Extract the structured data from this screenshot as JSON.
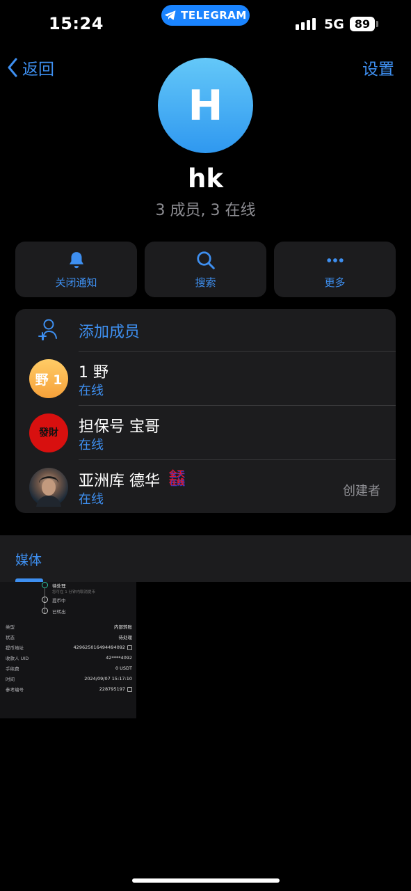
{
  "status_bar": {
    "time": "15:24",
    "app_pill": "TELEGRAM",
    "network": "5G",
    "battery": "89"
  },
  "nav": {
    "back_label": "返回",
    "settings_label": "设置"
  },
  "group": {
    "avatar_letter": "H",
    "name": "hk",
    "subtitle": "3 成员, 3 在线"
  },
  "actions": [
    {
      "label": "关闭通知",
      "icon": "bell-icon"
    },
    {
      "label": "搜索",
      "icon": "search-icon"
    },
    {
      "label": "更多",
      "icon": "more-icon"
    }
  ],
  "add_member_label": "添加成员",
  "members": [
    {
      "name": "1 野",
      "status": "在线",
      "avatar_text": "野 1",
      "role": ""
    },
    {
      "name": "担保号 宝哥",
      "status": "在线",
      "avatar_text": "發財",
      "role": ""
    },
    {
      "name": "亚洲库 德华",
      "status": "在线",
      "avatar_text": "",
      "role": "创建者",
      "badge": "全天在线"
    }
  ],
  "media": {
    "tab_label": "媒体",
    "thumbnail": {
      "steps": [
        {
          "title": "待处理",
          "sub": "您可在 1 分钟内取消提币"
        },
        {
          "title": "提币中",
          "sub": ""
        },
        {
          "title": "已转出",
          "sub": ""
        }
      ],
      "details": [
        {
          "key": "类型",
          "value": "内部转账"
        },
        {
          "key": "状态",
          "value": "待处理"
        },
        {
          "key": "提币地址",
          "value": "4296250164944940​92"
        },
        {
          "key": "收款人 UID",
          "value": "42****4092"
        },
        {
          "key": "手续费",
          "value": "0 USDT"
        },
        {
          "key": "时间",
          "value": "2024/09/07 15:17:10"
        },
        {
          "key": "参考编号",
          "value": "228795197"
        }
      ]
    }
  },
  "colors": {
    "accent": "#3e8ff0",
    "card_bg": "#1c1c1e",
    "secondary_text": "#8e8e93"
  }
}
